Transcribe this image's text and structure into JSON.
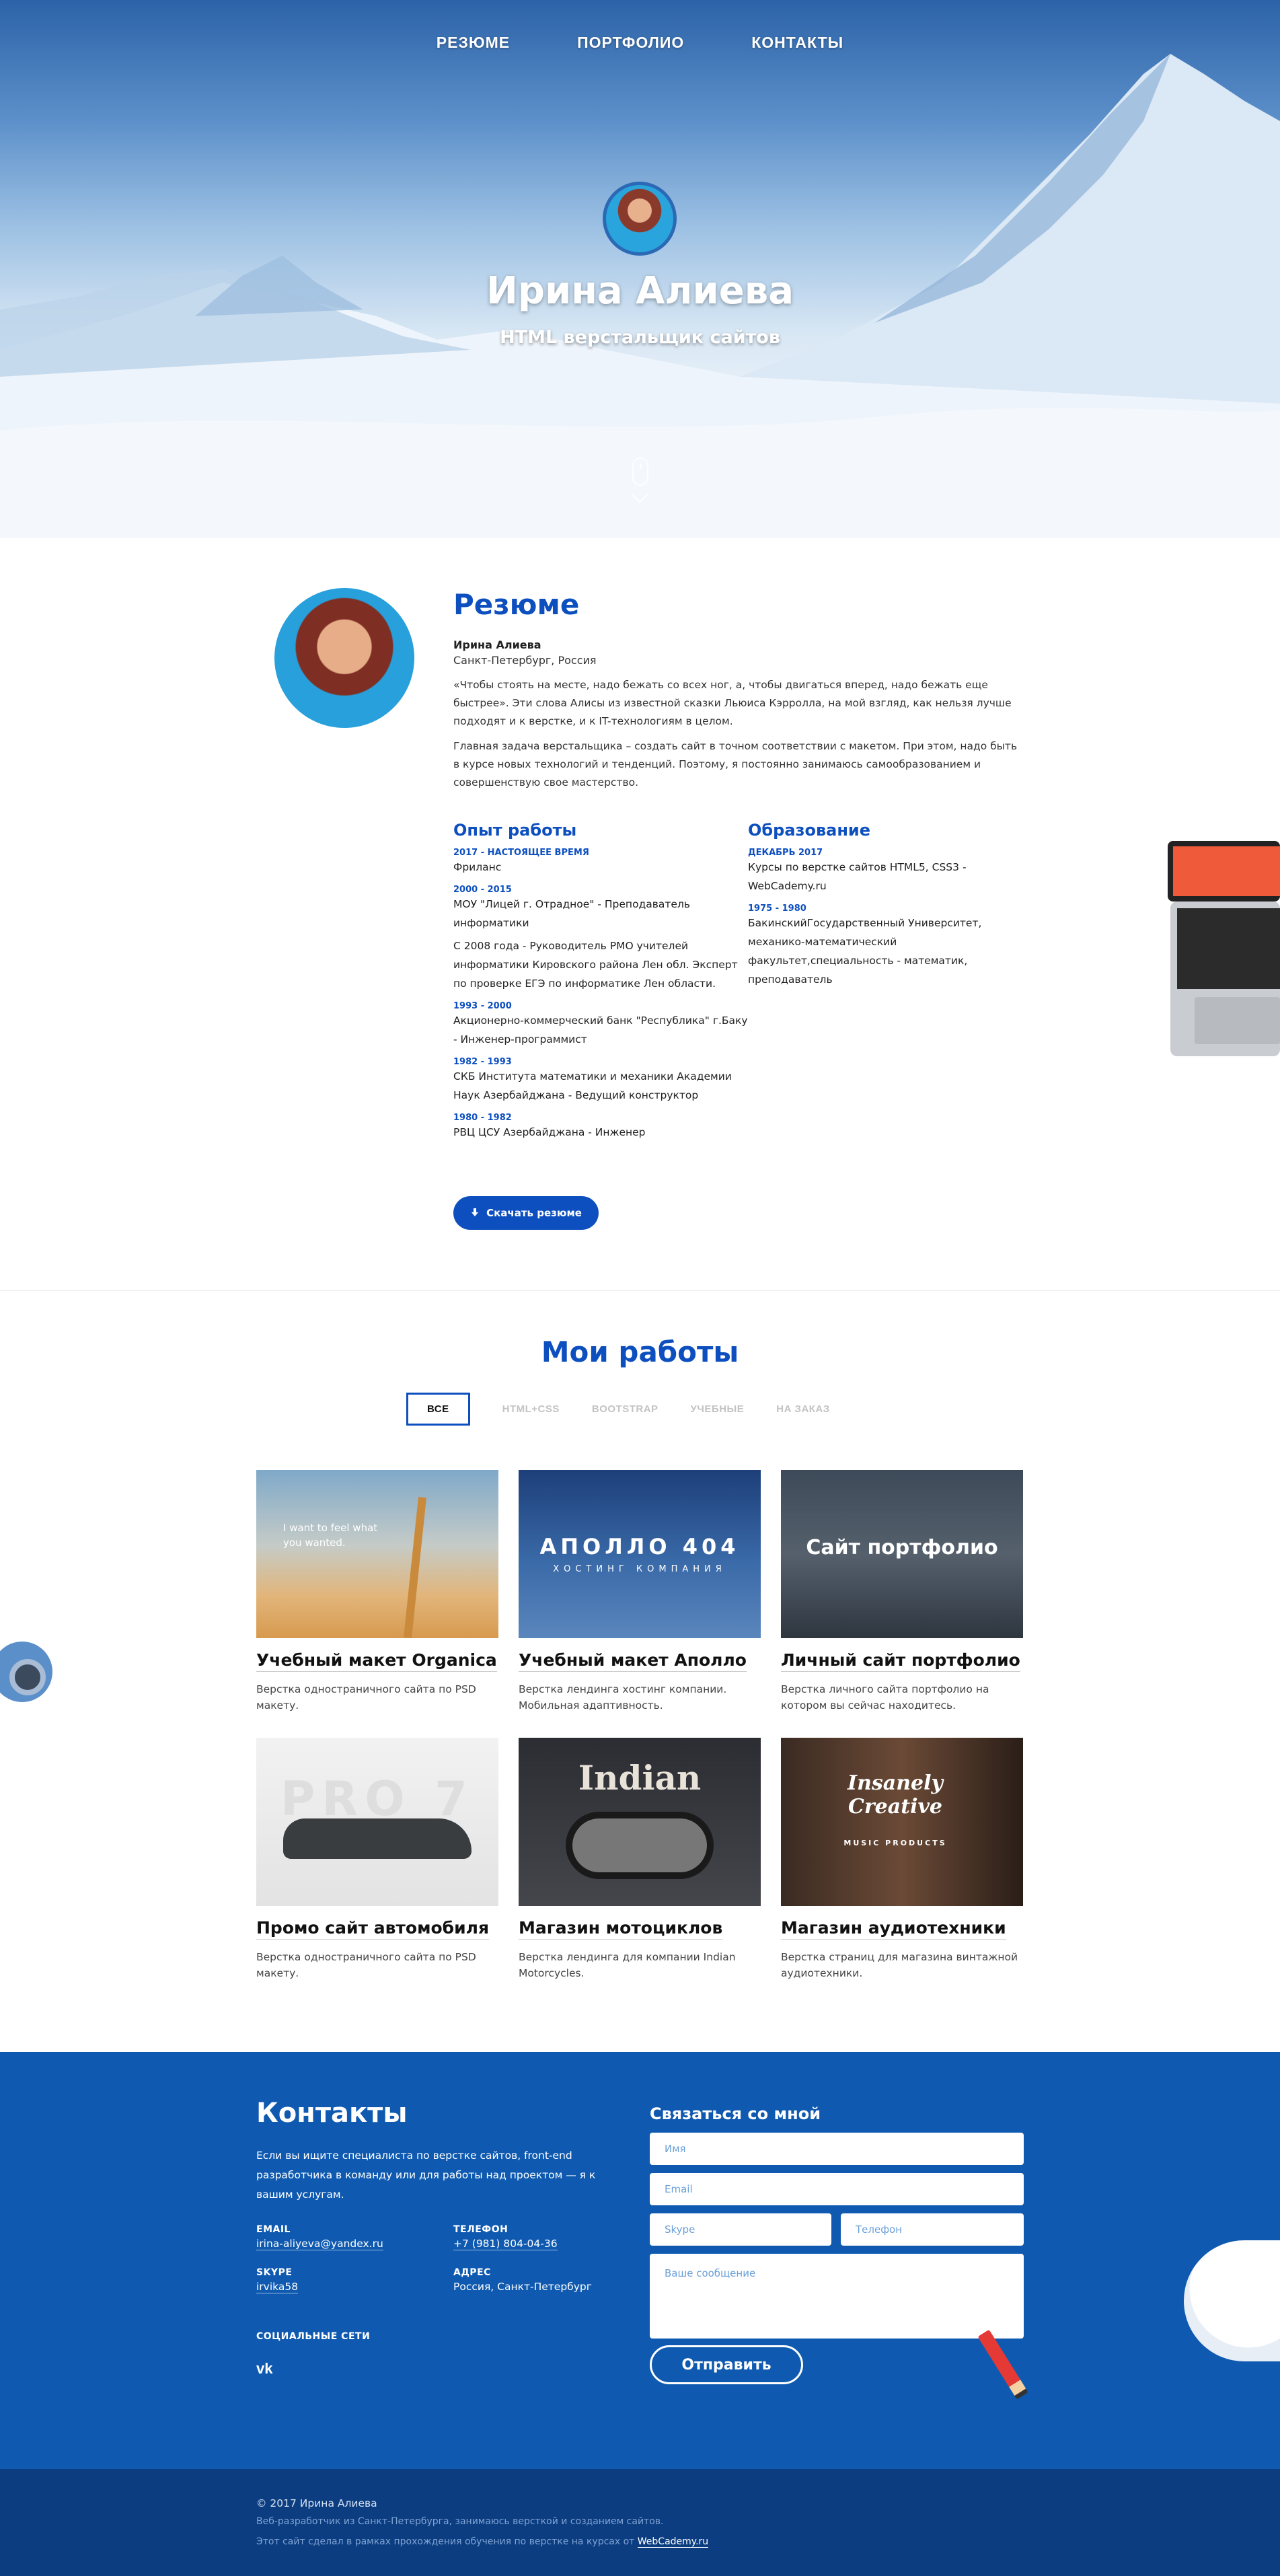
{
  "nav": [
    "РЕЗЮМЕ",
    "ПОРТФОЛИО",
    "КОНТАКТЫ"
  ],
  "hero": {
    "name": "Ирина Алиева",
    "subtitle": "HTML верстальщик сайтов"
  },
  "resume": {
    "title": "Резюме",
    "name": "Ирина Алиева",
    "city": "Санкт-Петербург, Россия",
    "paragraphs": [
      "«Чтобы стоять на месте, надо бежать со всех ног, а, чтобы двигаться вперед, надо бежать еще быстрее». Эти слова Алисы из известной сказки Льюиса Кэрролла, на мой взгляд, как нельзя лучше подходят и к верстке, и к IT-технологиям в целом.",
      "Главная задача верстальщика – создать сайт в точном соответствии с макетом. При этом, надо быть в курсе новых технологий и тенденций. Поэтому, я постоянно занимаюсь самообразованием и совершенствую свое мастерство."
    ],
    "experience": {
      "title": "Опыт работы",
      "entries": [
        {
          "date": "2017 - НАСТОЯЩЕЕ ВРЕМЯ",
          "texts": [
            "Фриланс"
          ]
        },
        {
          "date": "2000 - 2015",
          "texts": [
            "МОУ \"Лицей г. Отрадное\" - Преподаватель информатики",
            "С 2008 года - Руководитель РМО учителей информатики Кировского района Лен обл. Эксперт по проверке ЕГЭ по информатике Лен области."
          ]
        },
        {
          "date": "1993 - 2000",
          "texts": [
            "Акционерно-коммерческий банк \"Республика\" г.Баку - Инженер-программист"
          ]
        },
        {
          "date": "1982 - 1993",
          "texts": [
            "СКБ Института математики и механики Академии Наук Азербайджана - Ведущий конструктор"
          ]
        },
        {
          "date": "1980 - 1982",
          "texts": [
            "РВЦ ЦСУ Азербайджана - Инженер"
          ]
        }
      ]
    },
    "education": {
      "title": "Образование",
      "entries": [
        {
          "date": "ДЕКАБРЬ 2017",
          "texts": [
            "Курсы по верстке сайтов HTML5, CSS3 - WebCademy.ru"
          ]
        },
        {
          "date": "1975 - 1980",
          "texts": [
            "БакинскийГосударственный Университет, механико-математический факультет,специальность - математик, преподаватель"
          ]
        }
      ]
    },
    "download_label": "Скачать резюме"
  },
  "works": {
    "title": "Мои работы",
    "filters": [
      "ВСЕ",
      "HTML+CSS",
      "BOOTSTRAP",
      "УЧЕБНЫЕ",
      "НА ЗАКАЗ"
    ],
    "items": [
      {
        "title": "Учебный макет Organica",
        "desc": "Верстка одностраничного сайта по PSD макету.",
        "thumb_text": "I want to feel what you wanted.",
        "thumb_sub": ""
      },
      {
        "title": "Учебный макет Аполло",
        "desc": "Верстка лендинга хостинг компании. Мобильная адаптивность.",
        "thumb_text": "АПОЛЛО 404",
        "thumb_sub": "ХОСТИНГ КОМПАНИЯ"
      },
      {
        "title": "Личный сайт портфолио",
        "desc": "Верстка личного сайта портфолио на котором вы сейчас находитесь.",
        "thumb_text": "Сайт портфолио",
        "thumb_sub": ""
      },
      {
        "title": "Промо сайт автомобиля",
        "desc": "Верстка одностраничного сайта по PSD макету.",
        "thumb_text": "PRO 7",
        "thumb_sub": ""
      },
      {
        "title": "Магазин мотоциклов",
        "desc": "Верстка лендинга для компании Indian Motorcycles.",
        "thumb_text": "Indian",
        "thumb_sub": ""
      },
      {
        "title": "Магазин аудиотехники",
        "desc": "Верстка страниц для магазина винтажной аудиотехники.",
        "thumb_text": "Insanely Creative",
        "thumb_sub": "MUSIC PRODUCTS"
      }
    ]
  },
  "contacts": {
    "title": "Контакты",
    "text": "Если вы ищите специалиста по верстке сайтов, front-end разработчика в команду или для работы над проектом — я к вашим услугам.",
    "email_label": "EMAIL",
    "email": "irina-aliyeva@yandex.ru",
    "phone_label": "ТЕЛЕФОН",
    "phone": "+7 (981) 804-04-36",
    "skype_label": "SKYPE",
    "skype": "irvika58",
    "address_label": "АДРЕС",
    "address": "Россия, Санкт-Петербург",
    "social_label": "СОЦИАЛЬНЫЕ СЕТИ",
    "vk": "vk"
  },
  "form": {
    "title": "Связаться со мной",
    "name_placeholder": "Имя",
    "email_placeholder": "Email",
    "skype_placeholder": "Skype",
    "phone_placeholder": "Телефон",
    "message_placeholder": "Ваше сообщение",
    "submit_label": "Отправить"
  },
  "footer": {
    "copyright": "© 2017 Ирина Алиева",
    "about": "Веб-разработчик из Санкт-Петербурга, занимаюсь версткой и созданием сайтов.",
    "course_text": "Этот сайт сделал в рамках прохождения обучения по верстке на курсах от",
    "course_link": "WebCademy.ru"
  },
  "colors": {
    "accent": "#0d4fbf",
    "contacts_bg": "#0f5ab0",
    "footer_bg": "#0c3d80"
  }
}
